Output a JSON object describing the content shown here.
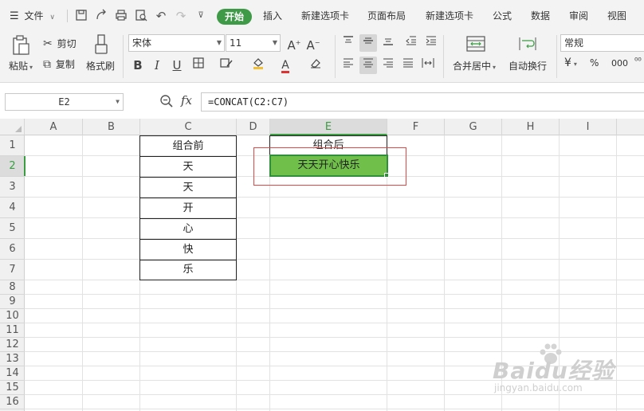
{
  "menubar": {
    "file_label": "文件",
    "tabs": [
      "开始",
      "插入",
      "新建选项卡",
      "页面布局",
      "新建选项卡",
      "公式",
      "数据",
      "审阅",
      "视图"
    ]
  },
  "ribbon": {
    "paste_label": "粘贴",
    "cut_label": "剪切",
    "copy_label": "复制",
    "format_painter_label": "格式刷",
    "font_name": "宋体",
    "font_size": "11",
    "bold": "B",
    "italic": "I",
    "underline": "U",
    "merge_center_label": "合并居中",
    "wrap_text_label": "自动换行",
    "number_format": "常规",
    "currency_symbol": "¥",
    "percent_symbol": "%",
    "thousands_symbol": "000"
  },
  "formula_bar": {
    "name_box": "E2",
    "fx_label": "fx",
    "formula": "=CONCAT(C2:C7)"
  },
  "grid": {
    "columns": [
      "A",
      "B",
      "C",
      "D",
      "E",
      "F",
      "G",
      "H",
      "I"
    ],
    "rows": [
      "1",
      "2",
      "3",
      "4",
      "5",
      "6",
      "7",
      "8",
      "9",
      "10",
      "11",
      "12",
      "13",
      "14",
      "15",
      "16"
    ],
    "selected_column": "E",
    "selected_row": "2",
    "column_c": [
      "组合前",
      "天",
      "天",
      "开",
      "心",
      "快",
      "乐"
    ],
    "e1": "组合后",
    "e2": "天天开心快乐"
  },
  "colors": {
    "accent_green": "#3f9a47",
    "cell_fill": "#6fbf4a",
    "highlight_red": "#e04848"
  },
  "watermark": {
    "brand": "Baidu经验",
    "domain": "jingyan.baidu.com"
  }
}
